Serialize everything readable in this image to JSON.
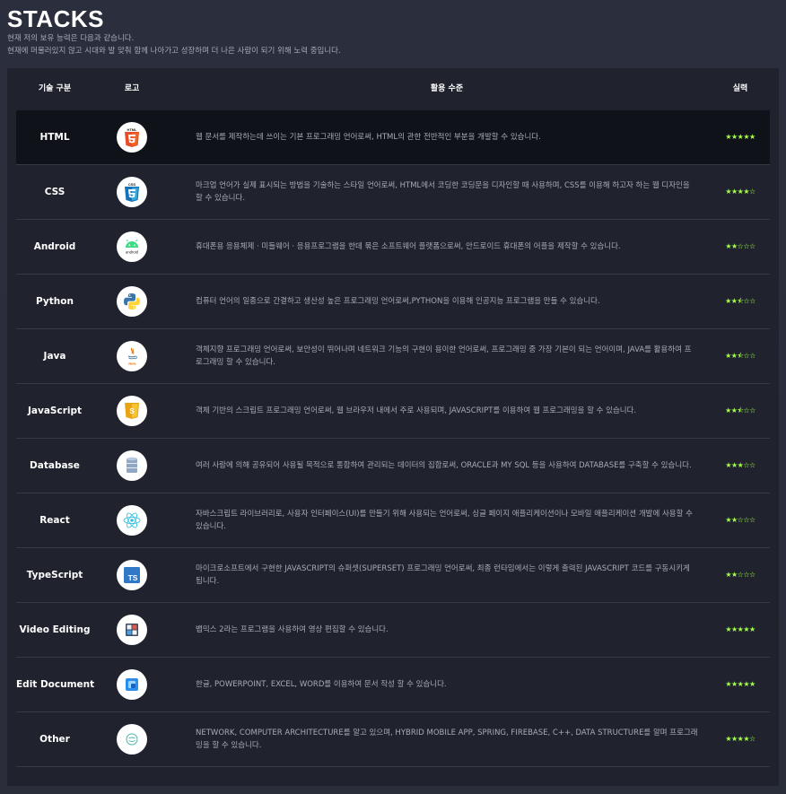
{
  "header": {
    "title": "STACKS",
    "subtitle_line1": "현재 저의 보유 능력은 다음과 같습니다.",
    "subtitle_line2": "현재에 머물러있지 않고 시대와 발 맞춰 함께 나아가고 성장하며 더 나은 사람이 되기 위해 노력 중입니다."
  },
  "table": {
    "headers": {
      "category": "기술 구분",
      "logo": "로고",
      "level": "활용 수준",
      "skill": "실력"
    },
    "rows": [
      {
        "name": "HTML",
        "icon": "html5-icon",
        "desc": "웹 문서를 제작하는데 쓰이는 기본 프로그래밍 언어로써, HTML의 관한 전반적인 부분을 개발할 수 있습니다.",
        "stars": "★★★★★",
        "rating": 5
      },
      {
        "name": "CSS",
        "icon": "css3-icon",
        "desc": "마크업 언어가 실제 표시되는 방법을 기술하는 스타일 언어로써, HTML에서 코딩한 코딩문을 디자인할 때 사용하며, CSS를 이용해 하고자 하는 웹 디자인을 할 수 있습니다.",
        "stars": "★★★★☆",
        "rating": 4
      },
      {
        "name": "Android",
        "icon": "android-icon",
        "desc": "휴대폰용 응용체제 · 미들웨어 · 응용프로그램을 한데 묶은 소프트웨어 플랫폼으로써, 안드로이드 휴대폰의 어플을 제작할 수 있습니다.",
        "stars": "★★☆☆☆",
        "rating": 2
      },
      {
        "name": "Python",
        "icon": "python-icon",
        "desc": "컴퓨터 언어의 일종으로 간결하고 생산성 높은 프로그래밍 언어로써,PYTHON을 이용해 인공지능 프로그램을 만들 수 있습니다.",
        "stars": "★★⯪☆☆",
        "rating": 2.5
      },
      {
        "name": "Java",
        "icon": "java-icon",
        "desc": "객체지향 프로그래밍 언어로써, 보안성이 뛰어나며 네트워크 기능의 구현이 용이한 언어로써, 프로그래밍 중 가장 기본이 되는 언어이며, JAVA를 활용하여 프로그래밍 할 수 있습니다.",
        "stars": "★★⯪☆☆",
        "rating": 2.5
      },
      {
        "name": "JavaScript",
        "icon": "javascript-icon",
        "desc": "객체 기반의 스크립트 프로그래밍 언어로써, 웹 브라우저 내에서 주로 사용되며, JAVASCRIPT를 이용하여 웹 프로그래밍을 할 수 있습니다.",
        "stars": "★★⯪☆☆",
        "rating": 2.5
      },
      {
        "name": "Database",
        "icon": "database-icon",
        "desc": "여러 사람에 의해 공유되어 사용될 목적으로 통합하여 관리되는 데이터의 집합로써, ORACLE과 MY SQL 등을 사용하여 DATABASE를 구축할 수 있습니다.",
        "stars": "★★★☆☆",
        "rating": 3
      },
      {
        "name": "React",
        "icon": "react-icon",
        "desc": "자바스크립트 라이브러리로, 사용자 인터페이스(UI)를 만들기 위해 사용되는 언어로써, 싱글 페이지 애플리케이션이나 모바일 애플리케이션 개발에 사용할 수 있습니다.",
        "stars": "★★☆☆☆",
        "rating": 2
      },
      {
        "name": "TypeScript",
        "icon": "typescript-icon",
        "desc": "마이크로소프트에서 구현한 JAVASCRIPT의 슈퍼셋(SUPERSET) 프로그래밍 언어로써, 최종 런타임에서는 이렇게 출력된 JAVASCRIPT 코드를 구동시키게 됩니다.",
        "stars": "★★☆☆☆",
        "rating": 2
      },
      {
        "name": "Video Editing",
        "icon": "video-edit-icon",
        "desc": "뱁믹스 2라는 프로그램을 사용하여 영상 편집할 수 있습니다.",
        "stars": "★★★★★",
        "rating": 5
      },
      {
        "name": "Edit Document",
        "icon": "document-icon",
        "desc": "한글, POWERPOINT, EXCEL, WORD를 이용하여 문서 작성 할 수 있습니다.",
        "stars": "★★★★★",
        "rating": 5
      },
      {
        "name": "Other",
        "icon": "other-icon",
        "desc": "NETWORK, COMPUTER ARCHITECTURE를 알고 있으며, HYBRID MOBILE APP, SPRING, FIREBASE, C++, DATA STRUCTURE를 알며 프로그래밍을 할 수 있습니다.",
        "stars": "★★★★☆",
        "rating": 4
      }
    ]
  },
  "colors": {
    "background": "#2b2f3d",
    "panel": "#20232d",
    "active_row": "#10121a",
    "star": "#a4ff4a",
    "desc_text": "#a7abb5"
  }
}
